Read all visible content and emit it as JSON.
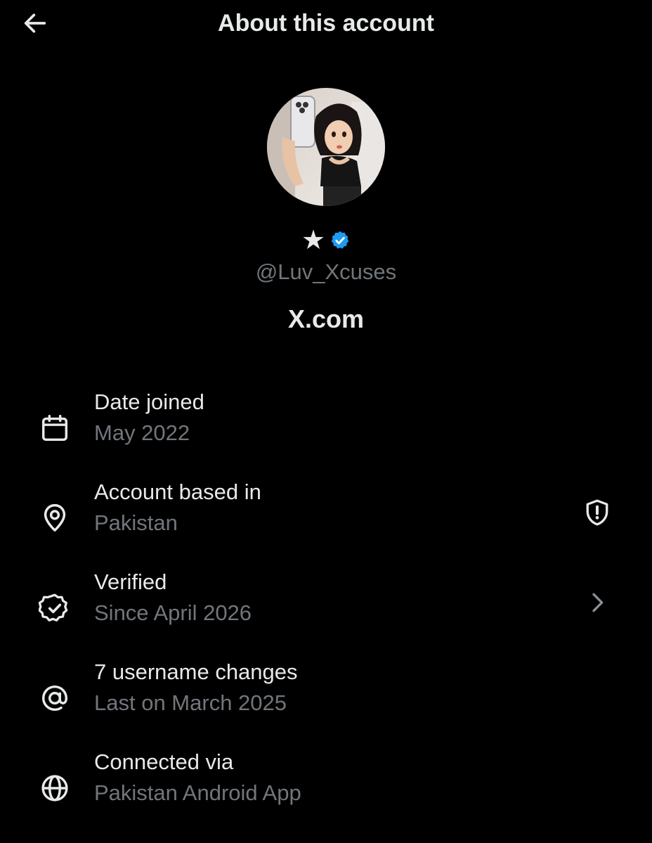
{
  "header": {
    "title": "About this account",
    "back_icon": "arrow-left-icon"
  },
  "profile": {
    "display_name_icon": "star-icon",
    "display_name": "★",
    "verified_badge_icon": "verified-badge-icon",
    "badge_color": "#1d9bf0",
    "handle": "@Luv_Xcuses",
    "website": "X.com"
  },
  "details": [
    {
      "icon": "calendar-icon",
      "label": "Date joined",
      "value": "May 2022"
    },
    {
      "icon": "location-pin-icon",
      "label": "Account based in",
      "value": "Pakistan",
      "trailing_icon": "shield-alert-icon"
    },
    {
      "icon": "verified-check-icon",
      "label": "Verified",
      "value": "Since April 2026",
      "trailing_icon": "chevron-right-icon"
    },
    {
      "icon": "at-sign-icon",
      "label": "7 username changes",
      "value": "Last on March 2025"
    },
    {
      "icon": "globe-icon",
      "label": "Connected via",
      "value": "Pakistan Android App"
    }
  ],
  "colors": {
    "background": "#000000",
    "primary_text": "#e7e9ea",
    "secondary_text": "#71767b",
    "accent_blue": "#1d9bf0"
  }
}
